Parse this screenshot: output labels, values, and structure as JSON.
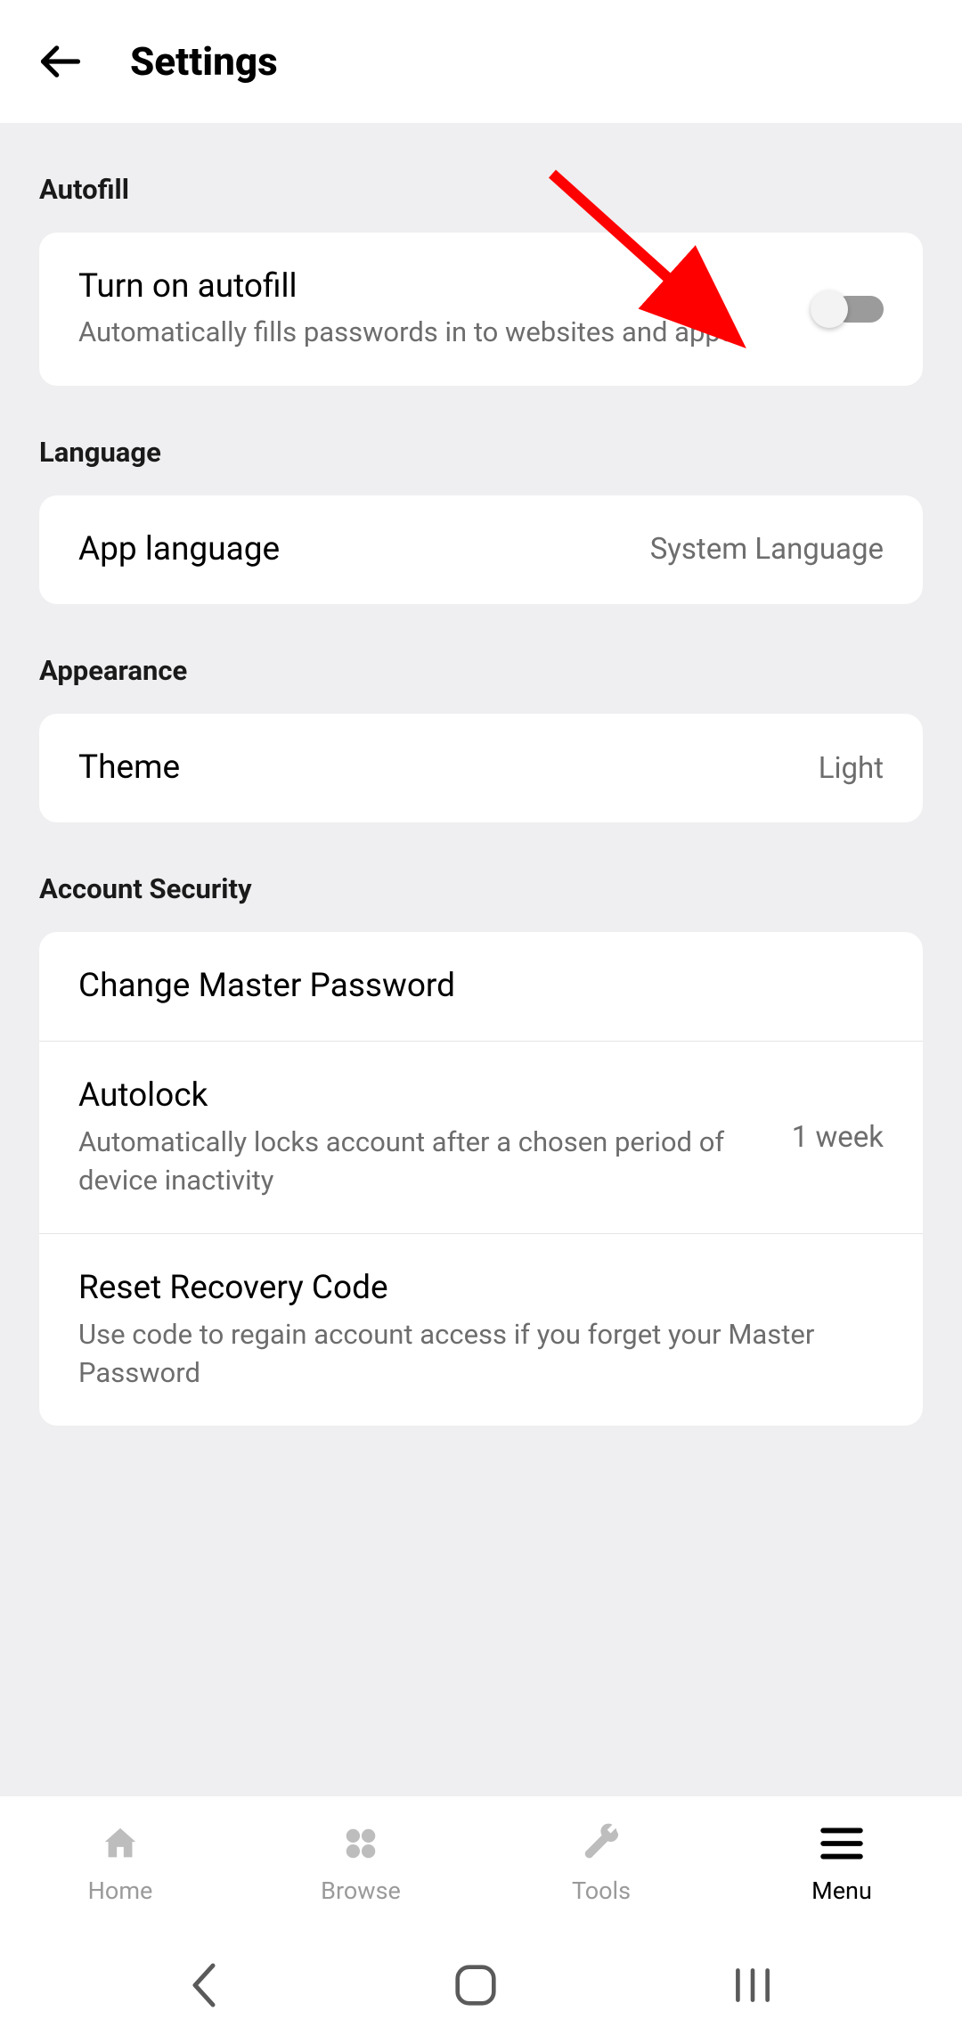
{
  "header": {
    "title": "Settings"
  },
  "sections": {
    "autofill": {
      "header": "Autofill",
      "turnOn": {
        "title": "Turn on autofill",
        "subtitle": "Automatically fills passwords in to websites and apps"
      }
    },
    "language": {
      "header": "Language",
      "appLanguage": {
        "title": "App language",
        "value": "System Language"
      }
    },
    "appearance": {
      "header": "Appearance",
      "theme": {
        "title": "Theme",
        "value": "Light"
      }
    },
    "accountSecurity": {
      "header": "Account Security",
      "changeMaster": {
        "title": "Change Master Password"
      },
      "autolock": {
        "title": "Autolock",
        "subtitle": "Automatically locks account after a chosen period of device inactivity",
        "value": "1 week"
      },
      "resetRecovery": {
        "title": "Reset Recovery Code",
        "subtitle": "Use code to regain account access if you forget your Master Password"
      }
    }
  },
  "nav": {
    "home": "Home",
    "browse": "Browse",
    "tools": "Tools",
    "menu": "Menu"
  }
}
